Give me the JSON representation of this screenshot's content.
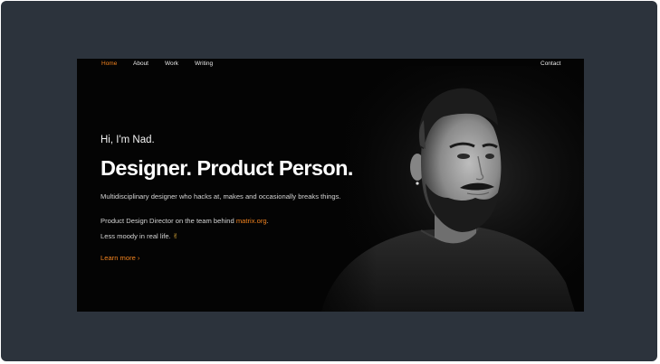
{
  "colors": {
    "frame_background": "#2c333c",
    "page_background": "#040404",
    "accent": "#f0821e"
  },
  "nav": {
    "home": "Home",
    "about": "About",
    "work": "Work",
    "writing": "Writing",
    "contact": "Contact"
  },
  "hero": {
    "greeting": "Hi, I'm Nad.",
    "headline": "Designer. Product Person.",
    "description": "Multidisciplinary designer who hacks at, makes and occasionally breaks things.",
    "role_prefix": "Product Design Director on the team behind ",
    "role_link": "matrix.org",
    "role_suffix": ".",
    "mood": "Less moody in real life.",
    "mood_emoji": "✌",
    "learn_more": "Learn more",
    "learn_more_chevron": "›"
  },
  "portrait": {
    "icon": "portrait-photo"
  }
}
